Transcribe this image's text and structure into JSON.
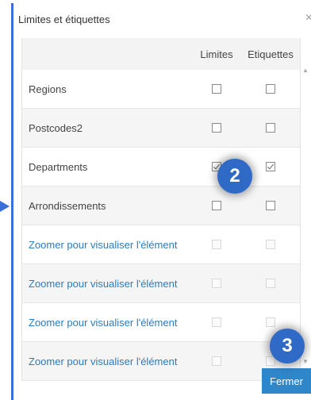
{
  "dialog": {
    "title": "Limites et étiquettes",
    "close_glyph": "×",
    "close_button_label": "Fermer"
  },
  "table": {
    "headers": [
      "",
      "Limites",
      "Etiquettes"
    ],
    "rows": [
      {
        "name": "Regions",
        "link": false,
        "limites": {
          "checked": false,
          "disabled": false
        },
        "etiquettes": {
          "checked": false,
          "disabled": false
        }
      },
      {
        "name": "Postcodes2",
        "link": false,
        "limites": {
          "checked": false,
          "disabled": false
        },
        "etiquettes": {
          "checked": false,
          "disabled": false
        }
      },
      {
        "name": "Departments",
        "link": false,
        "limites": {
          "checked": true,
          "disabled": false
        },
        "etiquettes": {
          "checked": true,
          "disabled": false
        }
      },
      {
        "name": "Arrondissements",
        "link": false,
        "limites": {
          "checked": false,
          "disabled": false
        },
        "etiquettes": {
          "checked": false,
          "disabled": false
        }
      },
      {
        "name": "Zoomer pour visualiser l'élément",
        "link": true,
        "limites": {
          "checked": false,
          "disabled": true
        },
        "etiquettes": {
          "checked": false,
          "disabled": true
        }
      },
      {
        "name": "Zoomer pour visualiser l'élément",
        "link": true,
        "limites": {
          "checked": false,
          "disabled": true
        },
        "etiquettes": {
          "checked": false,
          "disabled": true
        }
      },
      {
        "name": "Zoomer pour visualiser l'élément",
        "link": true,
        "limites": {
          "checked": false,
          "disabled": true
        },
        "etiquettes": {
          "checked": false,
          "disabled": true
        }
      },
      {
        "name": "Zoomer pour visualiser l'élément",
        "link": true,
        "limites": {
          "checked": false,
          "disabled": true
        },
        "etiquettes": {
          "checked": false,
          "disabled": true
        }
      }
    ]
  },
  "annotations": [
    {
      "label": "2"
    },
    {
      "label": "3"
    }
  ],
  "colors": {
    "accent": "#2f6ac7",
    "link": "#2b7bbf",
    "button": "#2f86c9"
  }
}
